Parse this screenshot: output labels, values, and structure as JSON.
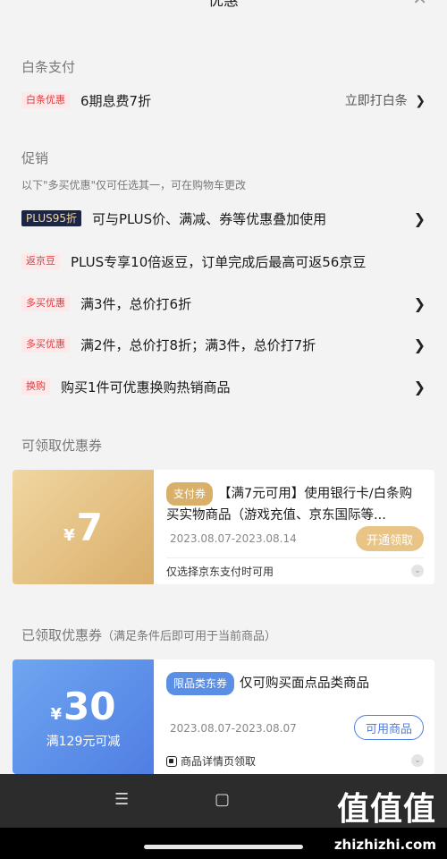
{
  "header": {
    "title": "优惠",
    "close_icon": "close-icon"
  },
  "baitiao": {
    "section_title": "白条支付",
    "tag": "白条优惠",
    "text": "6期息费7折",
    "action": "立即打白条",
    "action_chev": "❯"
  },
  "promo": {
    "section_title": "促销",
    "note": "以下\"多买优惠\"仅可任选其一，可在购物车更改",
    "rows": [
      {
        "tag": "PLUS95折",
        "text": "可与PLUS价、满减、券等优惠叠加使用",
        "chev": "❯"
      },
      {
        "tag": "返京豆",
        "text": "PLUS专享10倍返豆，订单完成后最高可返56京豆",
        "chev": ""
      },
      {
        "tag": "多买优惠",
        "text": "满3件，总价打6折",
        "chev": "❯"
      },
      {
        "tag": "多买优惠",
        "text": "满2件，总价打8折；满3件，总价打7折",
        "chev": "❯"
      },
      {
        "tag": "换购",
        "text": "购买1件可优惠换购热销商品",
        "chev": "❯"
      }
    ]
  },
  "claimable": {
    "section_title": "可领取优惠券",
    "coupon": {
      "currency": "¥",
      "amount": "7",
      "tag": "支付券",
      "title": "【满7元可用】使用银行卡/白条购买实物商品（游戏充值、京东国际等...",
      "date": "2023.08.07-2023.08.14",
      "button": "开通领取",
      "footer": "仅选择京东支付时可用"
    }
  },
  "claimed": {
    "section_title": "已领取优惠券",
    "section_note": "（满足条件后即可用于当前商品）",
    "coupon": {
      "currency": "¥",
      "amount": "30",
      "condition": "满129元可减",
      "tag": "限品类东券",
      "title": "仅可购买面点品类商品",
      "date": "2023.08.07-2023.08.07",
      "button": "可用商品",
      "footer": "商品详情页领取"
    }
  },
  "navbar": {
    "menu_icon": "☰",
    "home_icon": "▢",
    "watermark": "值值值",
    "watermark_url": "zhizhizhi.com"
  },
  "colors": {
    "accent_red": "#e4393c",
    "gold": "#d9b06a",
    "blue": "#4f7ee3"
  }
}
